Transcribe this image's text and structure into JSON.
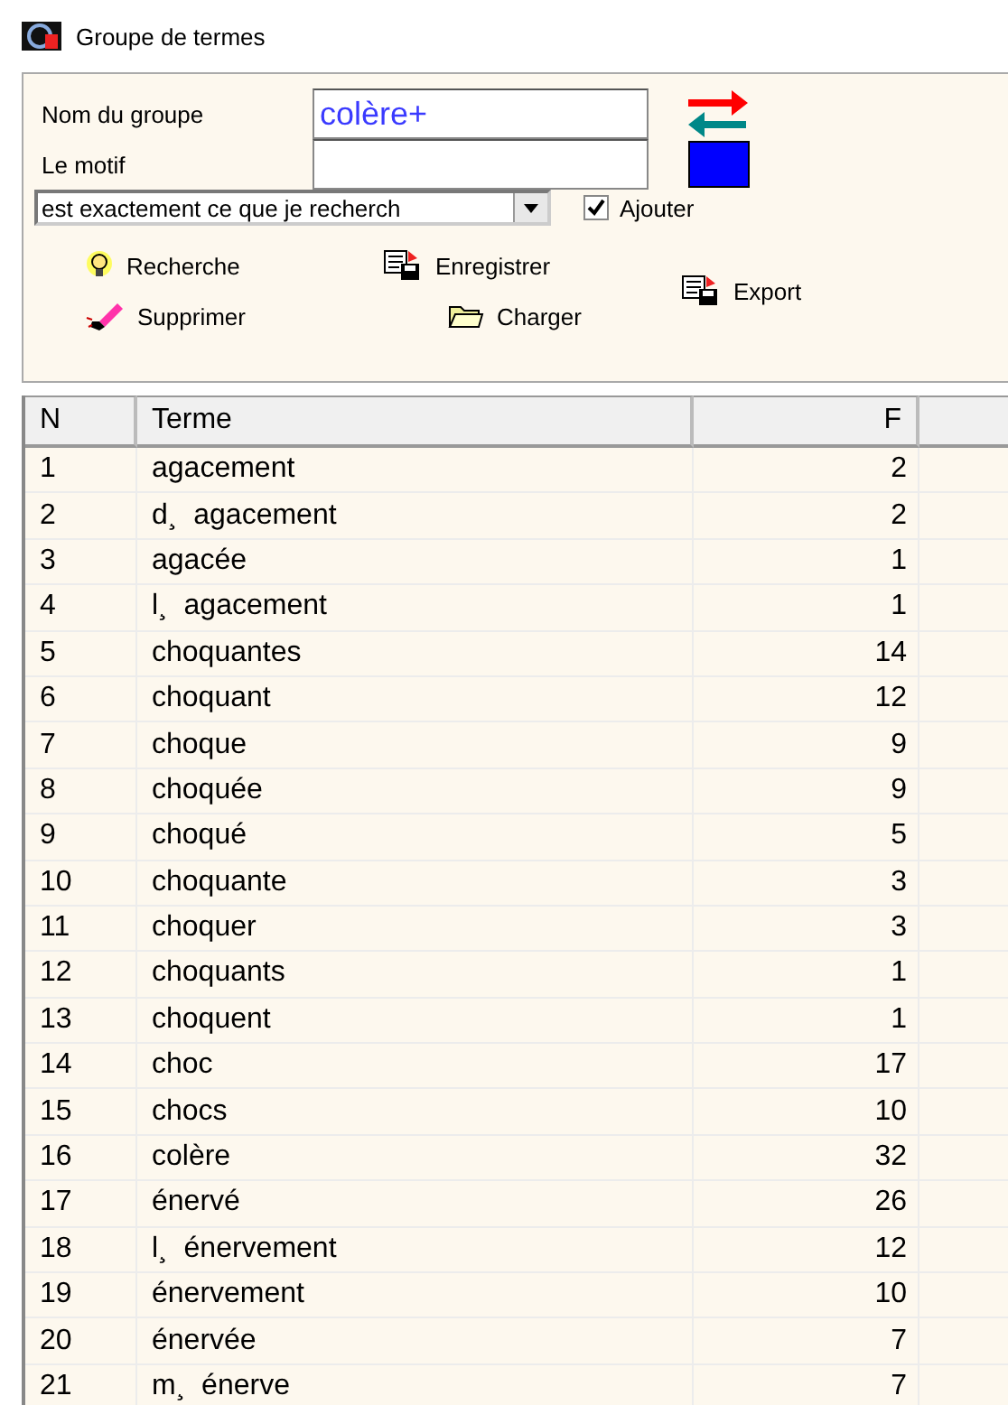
{
  "window": {
    "title": "Groupe de termes"
  },
  "form": {
    "group_name_label": "Nom du groupe",
    "group_name_value": "colère+",
    "pattern_label": "Le motif",
    "match_mode": "est exactement ce que je recherch",
    "add_label": "Ajouter",
    "add_checked": true
  },
  "buttons": [
    {
      "label": "Recherche",
      "kind": "search"
    },
    {
      "label": "Enregistrer",
      "kind": "save"
    },
    {
      "label": "Export",
      "kind": "export"
    },
    {
      "label": "Supprimer",
      "kind": "delete"
    },
    {
      "label": "Charger",
      "kind": "load"
    }
  ],
  "table": {
    "columns": [
      "N",
      "Terme",
      "F"
    ],
    "rows": [
      [
        "1",
        "agacement",
        "2"
      ],
      [
        "2",
        "d¸  agacement",
        "2"
      ],
      [
        "3",
        "agacée",
        "1"
      ],
      [
        "4",
        "l¸  agacement",
        "1"
      ],
      [
        "5",
        "choquantes",
        "14"
      ],
      [
        "6",
        "choquant",
        "12"
      ],
      [
        "7",
        "choque",
        "9"
      ],
      [
        "8",
        "choquée",
        "9"
      ],
      [
        "9",
        "choqué",
        "5"
      ],
      [
        "10",
        "choquante",
        "3"
      ],
      [
        "11",
        "choquer",
        "3"
      ],
      [
        "12",
        "choquants",
        "1"
      ],
      [
        "13",
        "choquent",
        "1"
      ],
      [
        "14",
        "choc",
        "17"
      ],
      [
        "15",
        "chocs",
        "10"
      ],
      [
        "16",
        "colère",
        "32"
      ],
      [
        "17",
        "énervé",
        "26"
      ],
      [
        "18",
        "l¸  énervement",
        "12"
      ],
      [
        "19",
        "énervement",
        "10"
      ],
      [
        "20",
        "énervée",
        "7"
      ],
      [
        "21",
        "m¸  énerve",
        "7"
      ]
    ]
  }
}
